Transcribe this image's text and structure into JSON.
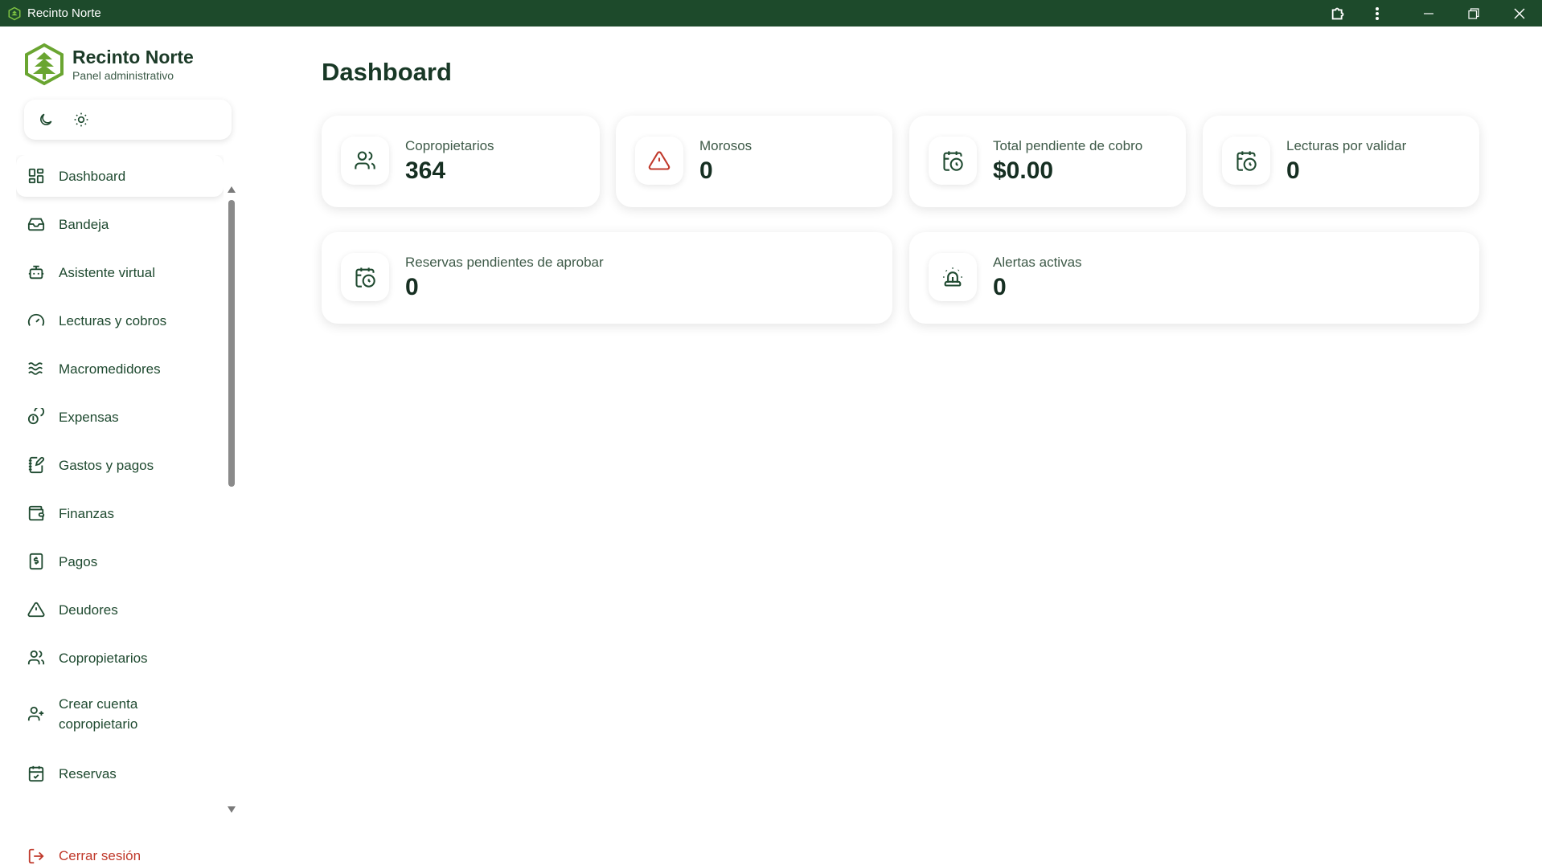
{
  "window": {
    "title": "Recinto Norte"
  },
  "brand": {
    "name": "Recinto Norte",
    "subtitle": "Panel administrativo"
  },
  "theme_toggle": {
    "options": [
      "moon-icon",
      "sun-icon"
    ]
  },
  "nav": {
    "items": [
      {
        "label": "Dashboard",
        "icon": "dashboard-icon",
        "active": true
      },
      {
        "label": "Bandeja",
        "icon": "inbox-icon"
      },
      {
        "label": "Asistente virtual",
        "icon": "bot-icon"
      },
      {
        "label": "Lecturas y cobros",
        "icon": "gauge-icon"
      },
      {
        "label": "Macromedidores",
        "icon": "waves-icon"
      },
      {
        "label": "Expensas",
        "icon": "coins-icon"
      },
      {
        "label": "Gastos y pagos",
        "icon": "notebook-pen-icon"
      },
      {
        "label": "Finanzas",
        "icon": "wallet-icon"
      },
      {
        "label": "Pagos",
        "icon": "receipt-icon"
      },
      {
        "label": "Deudores",
        "icon": "warning-icon"
      },
      {
        "label": "Copropietarios",
        "icon": "users-icon"
      },
      {
        "label": "Crear cuenta copropietario",
        "icon": "user-plus-icon"
      },
      {
        "label": "Reservas",
        "icon": "calendar-check-icon"
      }
    ]
  },
  "logout": {
    "label": "Cerrar sesión",
    "color": "#c0392b"
  },
  "main": {
    "title": "Dashboard",
    "cards": [
      {
        "label": "Copropietarios",
        "value": "364",
        "icon": "users-icon"
      },
      {
        "label": "Morosos",
        "value": "0",
        "icon": "warning-icon",
        "icon_color": "#c0392b"
      },
      {
        "label": "Total pendiente de cobro",
        "value": "$0.00",
        "icon": "calendar-clock-icon"
      },
      {
        "label": "Lecturas por validar",
        "value": "0",
        "icon": "calendar-clock-icon"
      },
      {
        "label": "Reservas pendientes de aprobar",
        "value": "0",
        "icon": "calendar-clock-icon"
      },
      {
        "label": "Alertas activas",
        "value": "0",
        "icon": "siren-icon"
      }
    ]
  },
  "colors": {
    "titlebar": "#1d4a2b",
    "accent": "#1f4a30",
    "danger": "#c0392b",
    "logo": "#6aa531"
  }
}
